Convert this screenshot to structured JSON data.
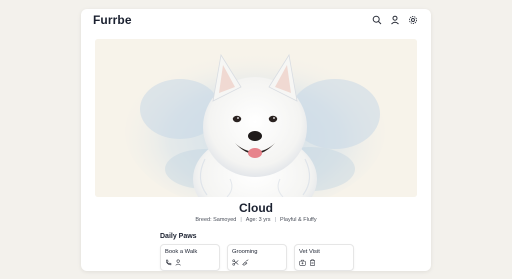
{
  "app": {
    "brand": "Furrbe"
  },
  "header": {
    "icons": [
      "search-icon",
      "user-icon",
      "settings-icon"
    ]
  },
  "pet": {
    "name": "Cloud",
    "breed": "Breed: Samoyed",
    "age": "Age: 3 yrs",
    "traits": "Playful & Fluffy"
  },
  "daily": {
    "title": "Daily Paws",
    "actions": [
      {
        "label": "Book a Walk",
        "icons": [
          "phone-icon",
          "person-icon"
        ]
      },
      {
        "label": "Grooming",
        "icons": [
          "scissors-icon",
          "brush-icon"
        ]
      },
      {
        "label": "Vet Visit",
        "icons": [
          "medical-bag-icon",
          "clipboard-icon"
        ]
      }
    ]
  },
  "colors": {
    "page_bg": "#f3f1ec",
    "card_bg": "#ffffff",
    "text_dark": "#1b2130",
    "watercolor_blue": "#b9cfe0"
  }
}
